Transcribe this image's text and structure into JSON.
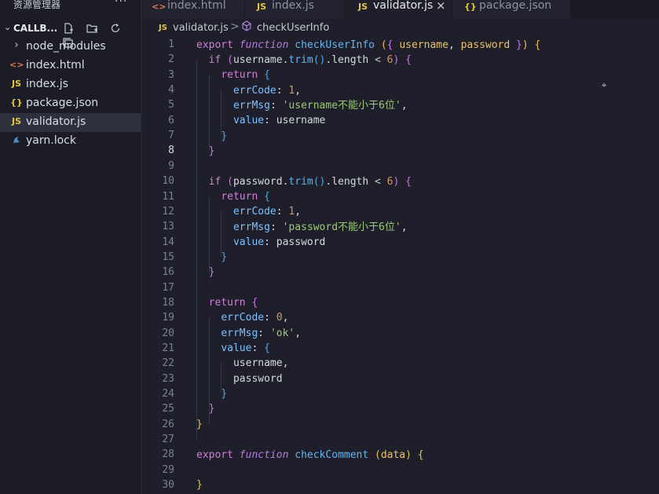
{
  "sidebar": {
    "title": "资源管理器",
    "more_label": "···",
    "section_title": "CALLB...",
    "items": [
      {
        "label": "node_modules",
        "icon": "chevron-right-icon"
      },
      {
        "label": "index.html",
        "icon": "html-file-icon"
      },
      {
        "label": "index.js",
        "icon": "js-file-icon"
      },
      {
        "label": "package.json",
        "icon": "json-file-icon"
      },
      {
        "label": "validator.js",
        "icon": "js-file-icon",
        "active": true
      },
      {
        "label": "yarn.lock",
        "icon": "yarn-file-icon"
      }
    ]
  },
  "tabs": [
    {
      "label": "index.html",
      "icon_text": "<>"
    },
    {
      "label": "index.js",
      "icon_text": "JS"
    },
    {
      "label": "validator.js",
      "icon_text": "JS",
      "active": true,
      "close": "×"
    },
    {
      "label": "package.json",
      "icon_text": "{}"
    }
  ],
  "breadcrumb": {
    "icon_text": "JS",
    "file": "validator.js",
    "separator": ">",
    "symbol": "checkUserInfo"
  },
  "editor": {
    "current_line": 8,
    "line_numbers": [
      "1",
      "2",
      "3",
      "4",
      "5",
      "6",
      "7",
      "8",
      "9",
      "10",
      "11",
      "12",
      "13",
      "14",
      "15",
      "16",
      "17",
      "18",
      "19",
      "20",
      "21",
      "22",
      "23",
      "24",
      "25",
      "26",
      "27",
      "28",
      "29",
      "30"
    ]
  },
  "colors": {
    "background": "#1e1f2a",
    "sidebar": "#1b1c25",
    "keyword": "#d17fd8",
    "function": "#64b5f0",
    "string": "#9dc976",
    "number": "#d19a66",
    "js_icon": "#e5c541"
  }
}
